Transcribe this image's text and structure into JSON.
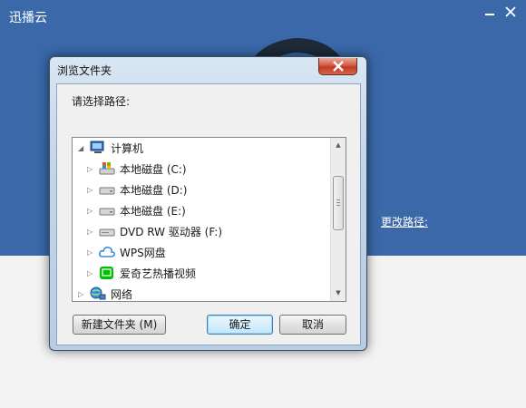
{
  "app": {
    "title": "迅播云",
    "change_path_link": "更改路径:",
    "colors": {
      "header_bg": "#3a68a8",
      "body_bg": "#f3f3f3"
    }
  },
  "dialog": {
    "title": "浏览文件夹",
    "prompt": "请选择路径:",
    "tree": [
      {
        "label": "计算机",
        "icon": "computer-icon",
        "expanded": true
      },
      {
        "label": "本地磁盘 (C:)",
        "icon": "windows-drive-icon"
      },
      {
        "label": "本地磁盘 (D:)",
        "icon": "hard-drive-icon"
      },
      {
        "label": "本地磁盘 (E:)",
        "icon": "hard-drive-icon"
      },
      {
        "label": "DVD RW 驱动器 (F:)",
        "icon": "dvd-drive-icon"
      },
      {
        "label": "WPS网盘",
        "icon": "cloud-icon"
      },
      {
        "label": "爱奇艺热播视频",
        "icon": "iqiyi-icon"
      },
      {
        "label": "网络",
        "icon": "network-icon"
      }
    ],
    "buttons": {
      "new_folder": "新建文件夹 (M)",
      "ok": "确定",
      "cancel": "取消"
    }
  }
}
